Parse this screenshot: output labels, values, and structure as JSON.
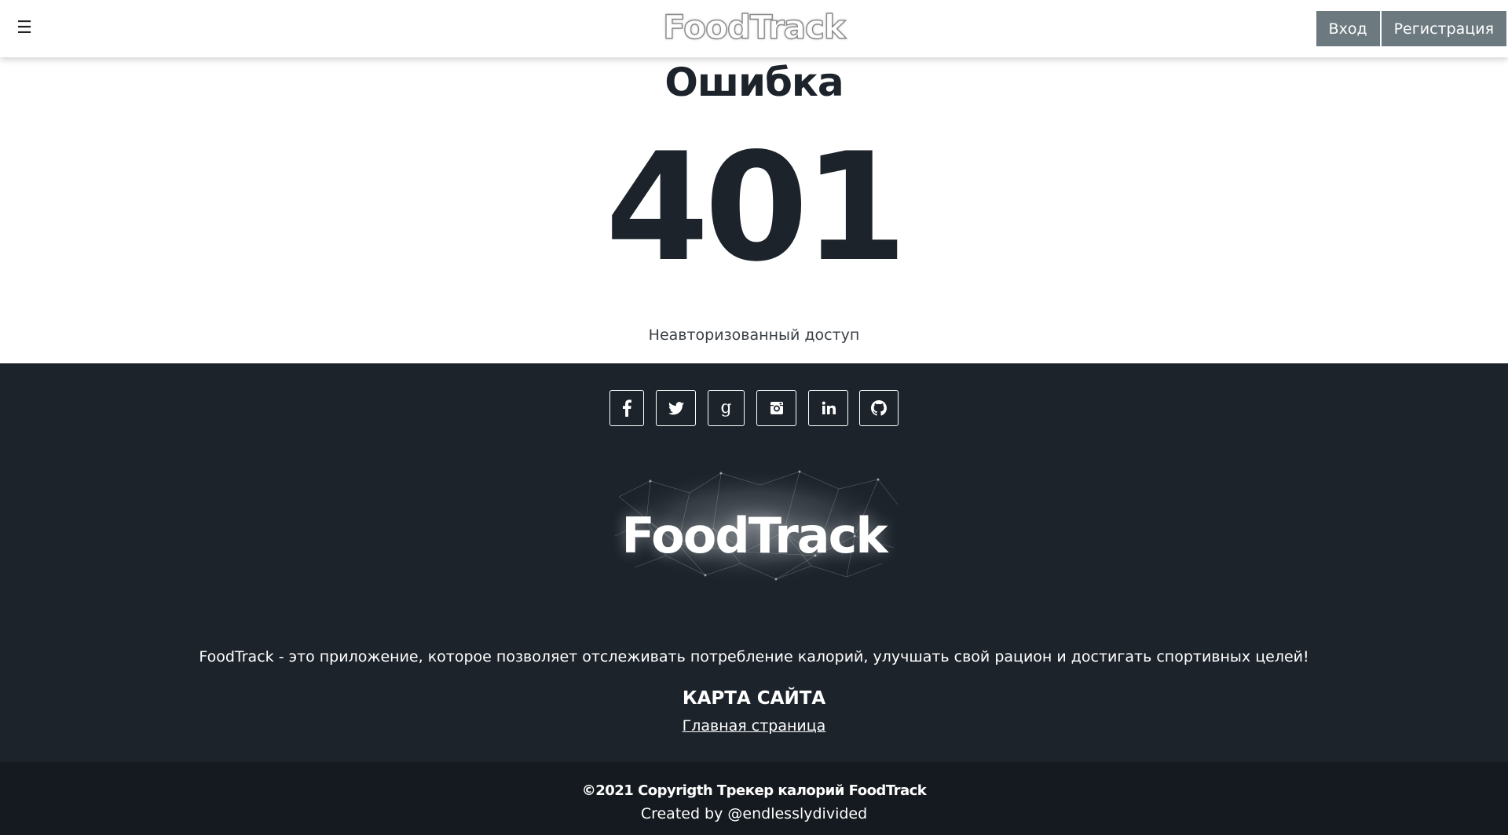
{
  "header": {
    "menu_icon": "☰",
    "logo": "FoodTrack",
    "login_label": "Вход",
    "register_label": "Регистрация"
  },
  "error": {
    "title": "Ошибка",
    "code": "401",
    "message": "Неавторизованный доступ"
  },
  "footer": {
    "social_icons": [
      "facebook-icon",
      "twitter-icon",
      "google-icon",
      "instagram-icon",
      "linkedin-icon",
      "github-icon"
    ],
    "logo": "FoodTrack",
    "description": "FoodTrack - это приложение, которое позволяет отслеживать потребление калорий, улучшать свой рацион и достигать спортивных целей!",
    "sitemap_title": "КАРТА САЙТА",
    "sitemap_link": "Главная страница"
  },
  "bottom": {
    "copyright": "©2021 Copyrigth Трекер калорий FoodTrack",
    "created_by": "Created by @endlesslydivided"
  },
  "colors": {
    "button_bg": "#6c7a80",
    "footer_bg": "#1c232b",
    "bottom_bg": "#141a1f",
    "text_dark": "#1c232b"
  }
}
